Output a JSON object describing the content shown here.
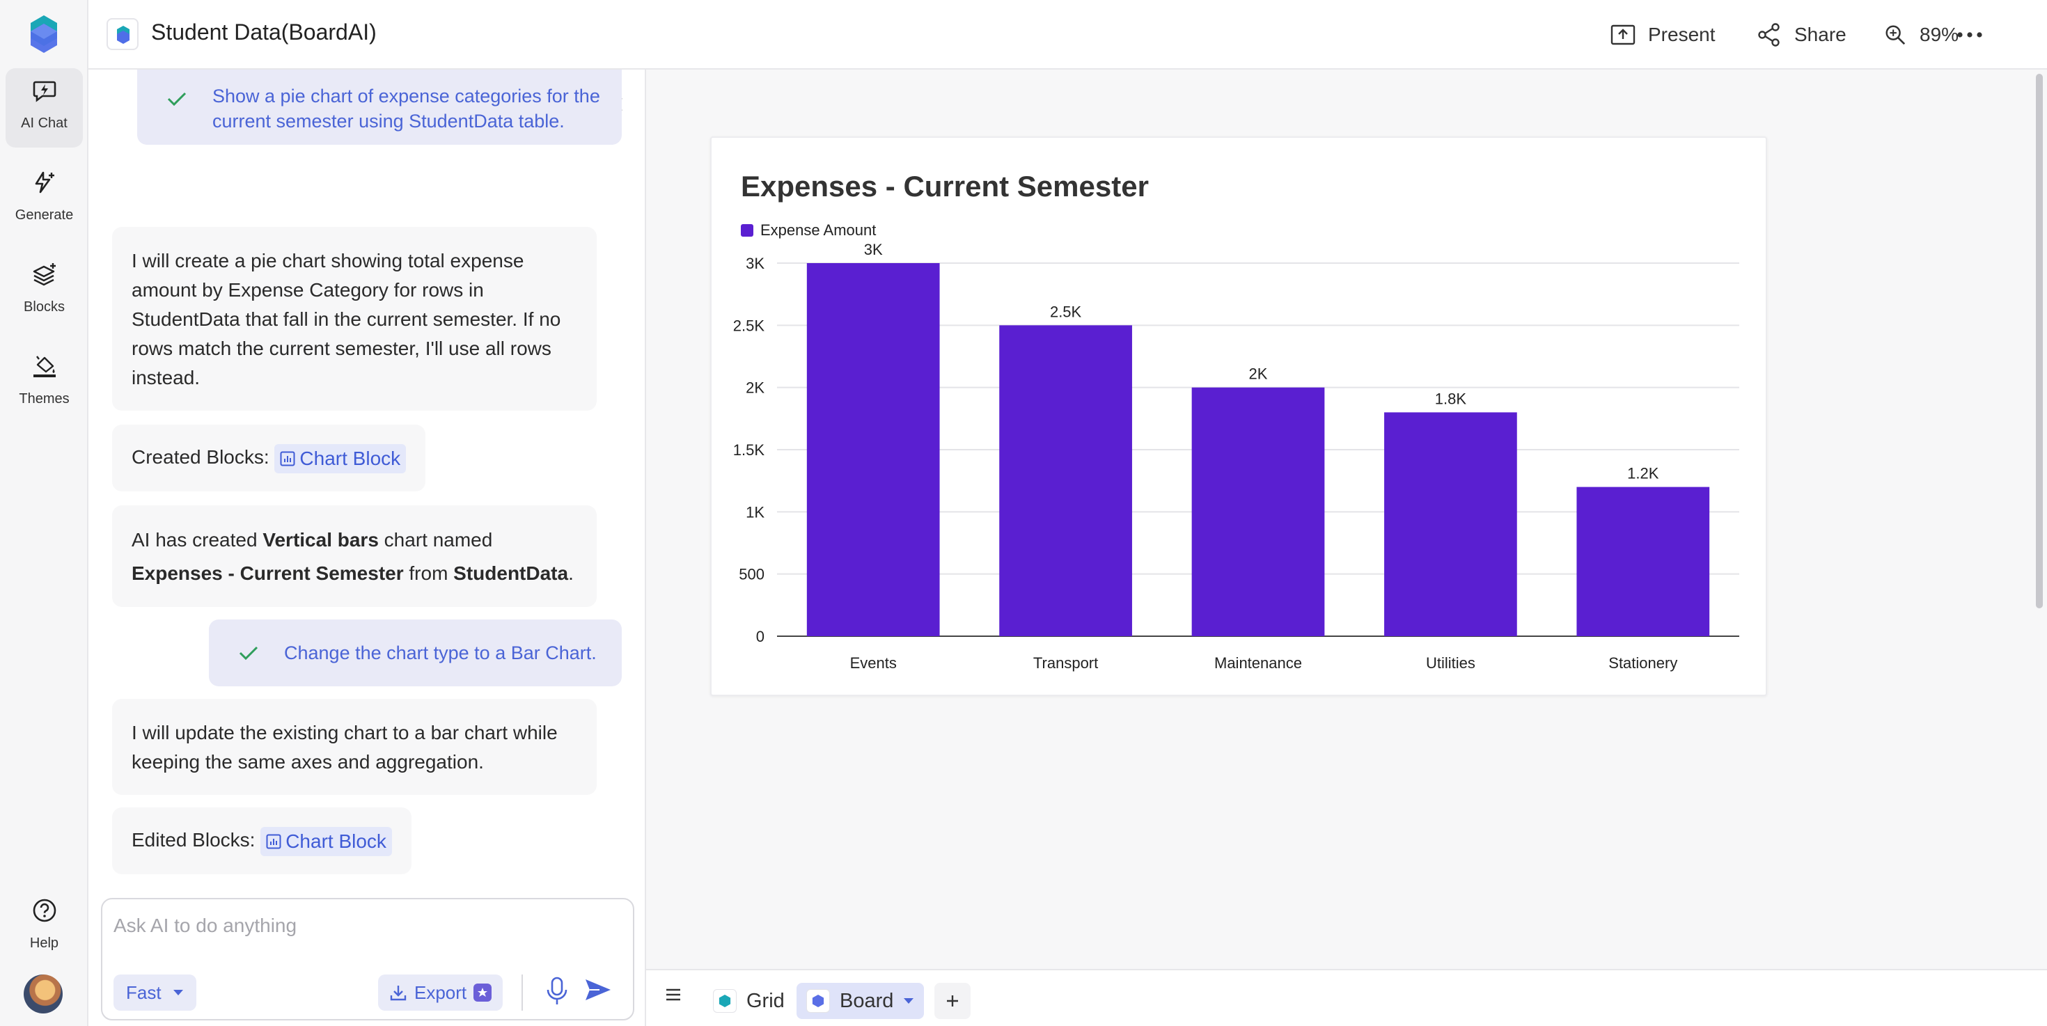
{
  "app": {
    "document_title": "Student Data(BoardAI)"
  },
  "rail": {
    "items": [
      {
        "label": "AI Chat",
        "icon": "ai-chat-icon",
        "active": true
      },
      {
        "label": "Generate",
        "icon": "generate-icon",
        "active": false
      },
      {
        "label": "Blocks",
        "icon": "blocks-icon",
        "active": false
      },
      {
        "label": "Themes",
        "icon": "themes-icon",
        "active": false
      }
    ],
    "help_label": "Help"
  },
  "topbar": {
    "present_label": "Present",
    "share_label": "Share",
    "zoom_label": "89%"
  },
  "chat": {
    "messages": [
      {
        "role": "user",
        "text": "Show a pie chart of expense categories for the current semester using StudentData table."
      },
      {
        "role": "ai",
        "text": "I will create a pie chart showing total expense amount by Expense Category for rows in StudentData that fall in the current semester. If no rows match the current semester, I'll use all rows instead."
      },
      {
        "role": "ai-blocks",
        "prefix": "Created Blocks:",
        "chip": "Chart Block"
      },
      {
        "role": "ai-rich",
        "t1": "AI has created ",
        "b1": "Vertical bars",
        "t2": " chart named ",
        "b2": "Expenses - Current Semester",
        "t3": " from ",
        "b3": "StudentData",
        "t4": "."
      },
      {
        "role": "user",
        "text": "Change the chart type to a Bar Chart."
      },
      {
        "role": "ai",
        "text": "I will update the existing chart to a bar chart while keeping the same axes and aggregation."
      },
      {
        "role": "ai-blocks",
        "prefix": "Edited Blocks:",
        "chip": "Chart Block"
      }
    ],
    "composer": {
      "placeholder": "Ask AI to do anything",
      "mode_label": "Fast",
      "export_label": "Export"
    }
  },
  "bottombar": {
    "tabs": [
      {
        "label": "Grid",
        "active": false
      },
      {
        "label": "Board",
        "active": true
      }
    ]
  },
  "colors": {
    "accent": "#4a64d6",
    "bar": "#5a1fd1",
    "check": "#2f9e5b"
  },
  "chart_data": {
    "type": "bar",
    "title": "Expenses - Current Semester",
    "categories": [
      "Events",
      "Transport",
      "Maintenance",
      "Utilities",
      "Stationery"
    ],
    "series": [
      {
        "name": "Expense Amount",
        "values": [
          3000,
          2500,
          2000,
          1800,
          1200
        ]
      }
    ],
    "data_labels": [
      "3K",
      "2.5K",
      "2K",
      "1.8K",
      "1.2K"
    ],
    "y_ticks": [
      0,
      500,
      1000,
      1500,
      2000,
      2500,
      3000
    ],
    "y_tick_labels": [
      "0",
      "500",
      "1K",
      "1.5K",
      "2K",
      "2.5K",
      "3K"
    ],
    "ylim": [
      0,
      3000
    ],
    "grid": true,
    "legend": "top-left"
  }
}
